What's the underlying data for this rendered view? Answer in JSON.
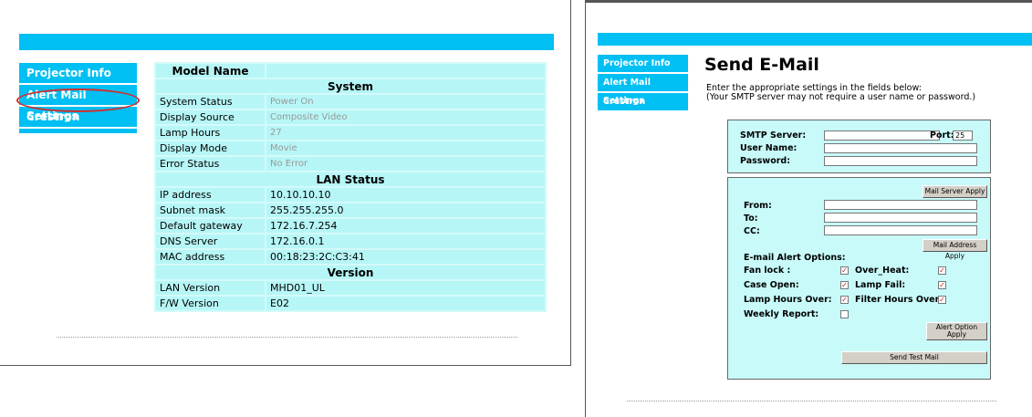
{
  "left_page": {
    "sidebar": [
      "Projector Info",
      "Alert Mail Settings",
      "Crestron"
    ],
    "table": {
      "model_label": "Model Name",
      "model_value": "",
      "system_header": "System",
      "system_rows": [
        {
          "label": "System Status",
          "value": "Power On"
        },
        {
          "label": "Display Source",
          "value": "Composite Video"
        },
        {
          "label": "Lamp Hours",
          "value": "27"
        },
        {
          "label": "Display Mode",
          "value": "Movie"
        },
        {
          "label": "Error Status",
          "value": "No Error"
        }
      ],
      "lan_header": "LAN Status",
      "lan_rows": [
        {
          "label": "IP address",
          "value": "10.10.10.10"
        },
        {
          "label": "Subnet mask",
          "value": "255.255.255.0"
        },
        {
          "label": "Default gateway",
          "value": "172.16.7.254"
        },
        {
          "label": "DNS Server",
          "value": "172.16.0.1"
        },
        {
          "label": "MAC address",
          "value": "00:18:23:2C:C3:41"
        }
      ],
      "version_header": "Version",
      "version_rows": [
        {
          "label": "LAN Version",
          "value": "MHD01_UL"
        },
        {
          "label": "F/W Version",
          "value": "E02"
        }
      ]
    }
  },
  "right_page": {
    "sidebar": [
      "Projector Info",
      "Alert Mail Settings",
      "Crestron"
    ],
    "title": "Send E-Mail",
    "intro_line1": "Enter the appropriate settings in the fields below:",
    "intro_line2": "(Your SMTP server may not require a user name or password.)",
    "server": {
      "smtp_label": "SMTP Server:",
      "port_label": "Port:",
      "port_value": "25",
      "user_label": "User Name:",
      "password_label": "Password:"
    },
    "mail_server_apply": "Mail Server Apply",
    "from_label": "From:",
    "to_label": "To:",
    "cc_label": "CC:",
    "mail_address_apply": "Mail Address Apply",
    "alert_options_label": "E-mail Alert Options:",
    "options": {
      "fan_lock": "Fan lock :",
      "over_heat": "Over_Heat:",
      "case_open": "Case Open:",
      "lamp_fail": "Lamp Fail:",
      "lamp_hours_over": "Lamp Hours Over:",
      "filter_hours_over": "Filter Hours Over:",
      "weekly_report": "Weekly Report:"
    },
    "checked": {
      "fan_lock": true,
      "over_heat": true,
      "case_open": true,
      "lamp_fail": true,
      "lamp_hours_over": true,
      "filter_hours_over": true,
      "weekly_report": false
    },
    "alert_option_apply": "Alert Option Apply",
    "send_test_mail": "Send Test Mail"
  },
  "colors": {
    "banner": "#00bff3",
    "table_cell": "#b7f6f6",
    "form_box": "#c8fafa",
    "highlight": "#d03030",
    "checkmark": "#c02020"
  }
}
